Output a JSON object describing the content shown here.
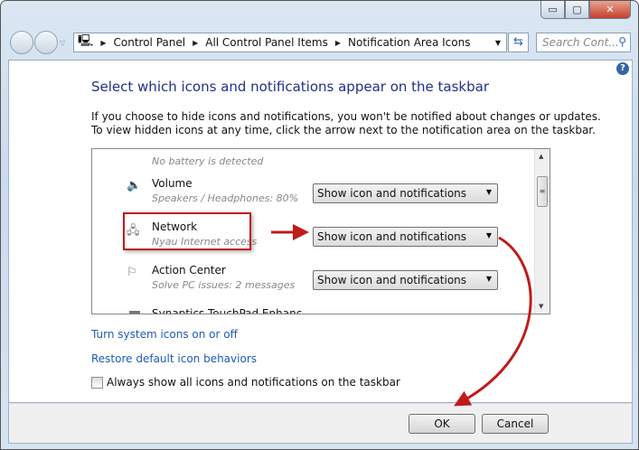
{
  "window": {
    "minimize": "minimize",
    "maximize": "maximize",
    "close": "close"
  },
  "address": {
    "crumbs": [
      "Control Panel",
      "All Control Panel Items",
      "Notification Area Icons"
    ]
  },
  "search": {
    "placeholder": "Search Cont..."
  },
  "page": {
    "title": "Select which icons and notifications appear on the taskbar",
    "desc1": "If you choose to hide icons and notifications, you won't be notified about changes or updates.",
    "desc2": "To view hidden icons at any time, click the arrow next to the notification area on the taskbar."
  },
  "items": [
    {
      "name": "",
      "sub": "No battery is detected",
      "behavior": ""
    },
    {
      "name": "Volume",
      "sub": "Speakers / Headphones: 80%",
      "behavior": "Show icon and notifications"
    },
    {
      "name": "Network",
      "sub": "Nyau Internet access",
      "behavior": "Show icon and notifications"
    },
    {
      "name": "Action Center",
      "sub": "Solve PC issues: 2 messages",
      "behavior": "Show icon and notifications"
    },
    {
      "name": "Synaptics TouchPad Enhanc",
      "sub": "",
      "behavior": ""
    }
  ],
  "links": {
    "system_icons": "Turn system icons on or off",
    "restore": "Restore default icon behaviors"
  },
  "always_show": {
    "label": "Always show all icons and notifications on the taskbar",
    "checked": false
  },
  "buttons": {
    "ok": "OK",
    "cancel": "Cancel"
  },
  "colors": {
    "annotation": "#c01a1a",
    "link": "#1e5bb5",
    "title": "#1e3287"
  }
}
